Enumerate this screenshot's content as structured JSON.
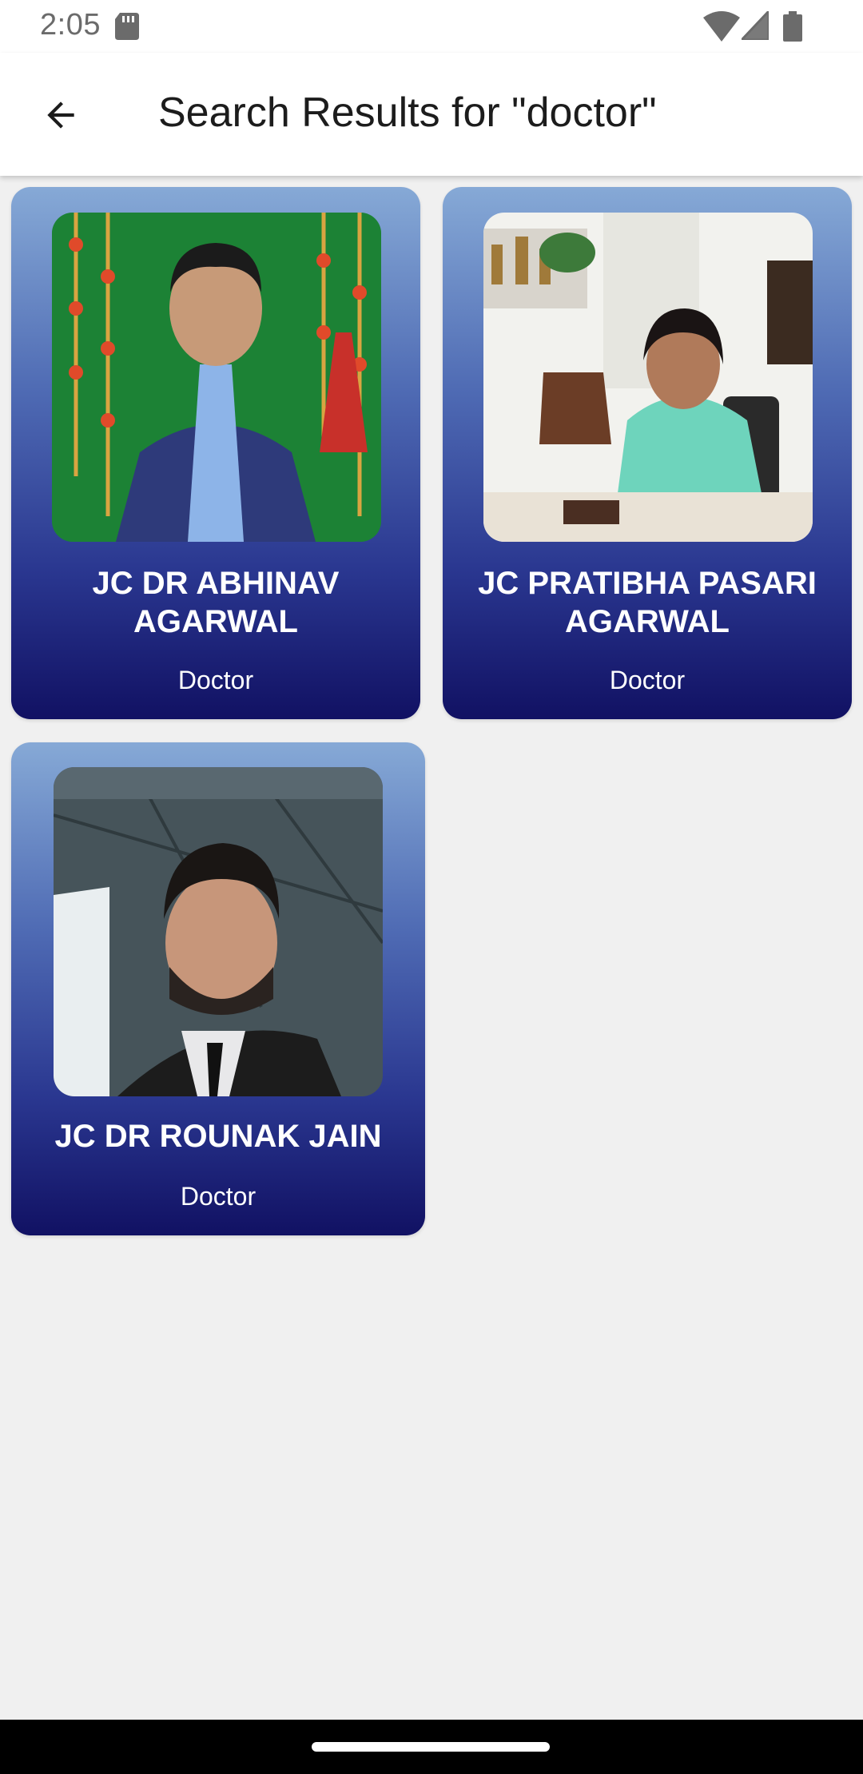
{
  "status_bar": {
    "time": "2:05",
    "icons": [
      "sd-card-icon",
      "wifi-icon",
      "cell-signal-icon",
      "battery-icon"
    ]
  },
  "app_bar": {
    "back_icon": "arrow-back-icon",
    "title": "Search Results for \"doctor\""
  },
  "results": [
    {
      "name": "JC DR ABHINAV AGARWAL",
      "role": "Doctor"
    },
    {
      "name": "JC PRATIBHA PASARI AGARWAL",
      "role": "Doctor"
    },
    {
      "name": "JC DR ROUNAK JAIN",
      "role": "Doctor"
    }
  ],
  "colors": {
    "card_gradient_top": "#86a9d6",
    "card_gradient_bottom": "#111163",
    "background": "#f0f0f0"
  }
}
